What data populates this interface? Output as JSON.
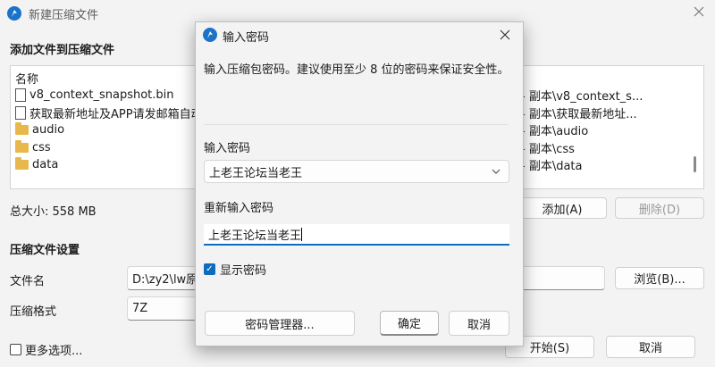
{
  "main_window": {
    "title": "新建压缩文件",
    "section_add": "添加文件到压缩文件",
    "list_header": "名称",
    "files": [
      {
        "icon": "file-icon",
        "name": "v8_context_snapshot.bin"
      },
      {
        "icon": "doc-icon",
        "name": "获取最新地址及APP请发邮箱自动"
      },
      {
        "icon": "folder-icon",
        "name": "audio"
      },
      {
        "icon": "folder-icon",
        "name": "css"
      },
      {
        "icon": "folder-icon",
        "name": "data"
      }
    ],
    "right_list": [
      "- 副本\\v8_context_s...",
      "- 副本\\获取最新地址...",
      "- 副本\\audio",
      "- 副本\\css",
      "- 副本\\data"
    ],
    "total_size": "总大小: 558 MB",
    "add_button": "添加(A)",
    "remove_button": "删除(D)",
    "section_settings": "压缩文件设置",
    "filename_label": "文件名",
    "filename_value": "D:\\zy2\\lw原\\",
    "browse_button": "浏览(B)...",
    "format_label": "压缩格式",
    "format_value": "7Z",
    "more_options": "更多选项...",
    "start_button": "开始(S)",
    "cancel_button": "取消"
  },
  "dialog": {
    "title": "输入密码",
    "instruction": "输入压缩包密码。建议使用至少 8 位的密码来保证安全性。",
    "password_label": "输入密码",
    "password_value": "上老王论坛当老王",
    "reenter_label": "重新输入密码",
    "reenter_value": "上老王论坛当老王",
    "show_password": "显示密码",
    "show_password_checked": true,
    "manager_button": "密码管理器...",
    "ok_button": "确定",
    "cancel_button": "取消"
  }
}
